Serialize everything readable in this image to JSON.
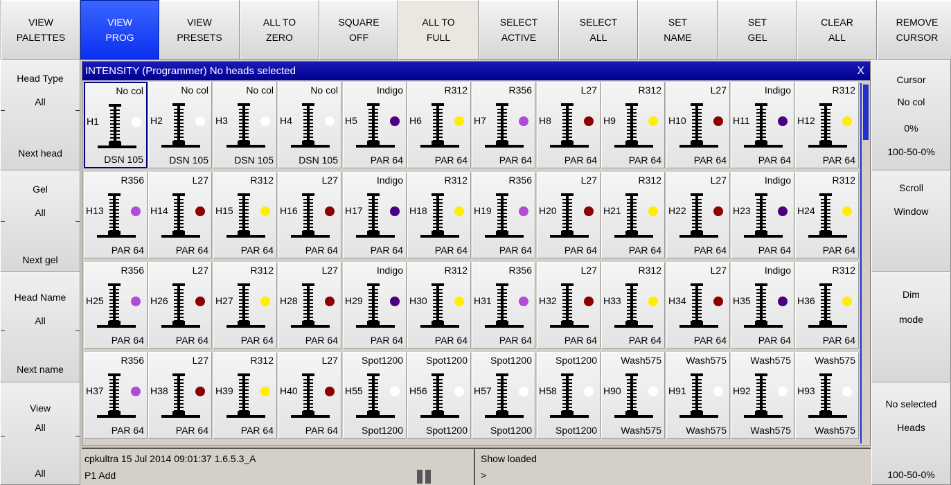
{
  "toolbar": [
    {
      "line1": "VIEW",
      "line2": "PALETTES",
      "state": "normal"
    },
    {
      "line1": "VIEW",
      "line2": "PROG",
      "state": "active"
    },
    {
      "line1": "VIEW",
      "line2": "PRESETS",
      "state": "normal"
    },
    {
      "line1": "ALL TO",
      "line2": "ZERO",
      "state": "normal"
    },
    {
      "line1": "SQUARE",
      "line2": "OFF",
      "state": "normal"
    },
    {
      "line1": "ALL TO",
      "line2": "FULL",
      "state": "pressed"
    },
    {
      "line1": "SELECT",
      "line2": "ACTIVE",
      "state": "normal"
    },
    {
      "line1": "SELECT",
      "line2": "ALL",
      "state": "normal"
    },
    {
      "line1": "SET",
      "line2": "NAME",
      "state": "normal"
    },
    {
      "line1": "SET",
      "line2": "GEL",
      "state": "normal"
    },
    {
      "line1": "CLEAR",
      "line2": "ALL",
      "state": "normal"
    },
    {
      "line1": "REMOVE",
      "line2": "CURSOR",
      "state": "normal"
    }
  ],
  "left_panel": [
    {
      "title": "Head Type",
      "value": "All",
      "footer": "Next head"
    },
    {
      "title": "Gel",
      "value": "All",
      "footer": "Next gel"
    },
    {
      "title": "Head Name",
      "value": "All",
      "footer": "Next name"
    },
    {
      "title": "View",
      "value": "All",
      "footer": "All"
    }
  ],
  "right_panel": {
    "cursor": {
      "title": "Cursor",
      "value": "No col",
      "percent": "0%",
      "range": "100-50-0%"
    },
    "scroll": {
      "line1": "Scroll",
      "line2": "Window"
    },
    "dim": {
      "line1": "Dim",
      "line2": "mode"
    },
    "heads": {
      "line1": "No selected",
      "line2": "Heads",
      "range": "100-50-0%"
    }
  },
  "window": {
    "title": "INTENSITY (Programmer) No heads selected",
    "close": "X"
  },
  "colors": {
    "white": "#ffffff",
    "purple": "#b44ad8",
    "yellow": "#ffee00",
    "darkred": "#8b0000",
    "indigo": "#4a0080",
    "accent": "#0b2ff0",
    "titlebar": "#000090"
  },
  "heads": [
    {
      "id": "H1",
      "gel": "No col",
      "type": "DSN 105",
      "dot": "white",
      "selected": true
    },
    {
      "id": "H2",
      "gel": "No col",
      "type": "DSN 105",
      "dot": "white"
    },
    {
      "id": "H3",
      "gel": "No col",
      "type": "DSN 105",
      "dot": "white"
    },
    {
      "id": "H4",
      "gel": "No col",
      "type": "DSN 105",
      "dot": "white"
    },
    {
      "id": "H5",
      "gel": "Indigo",
      "type": "PAR 64",
      "dot": "indigo"
    },
    {
      "id": "H6",
      "gel": "R312",
      "type": "PAR 64",
      "dot": "yellow"
    },
    {
      "id": "H7",
      "gel": "R356",
      "type": "PAR 64",
      "dot": "purple"
    },
    {
      "id": "H8",
      "gel": "L27",
      "type": "PAR 64",
      "dot": "darkred"
    },
    {
      "id": "H9",
      "gel": "R312",
      "type": "PAR 64",
      "dot": "yellow"
    },
    {
      "id": "H10",
      "gel": "L27",
      "type": "PAR 64",
      "dot": "darkred"
    },
    {
      "id": "H11",
      "gel": "Indigo",
      "type": "PAR 64",
      "dot": "indigo"
    },
    {
      "id": "H12",
      "gel": "R312",
      "type": "PAR 64",
      "dot": "yellow"
    },
    {
      "id": "H13",
      "gel": "R356",
      "type": "PAR 64",
      "dot": "purple"
    },
    {
      "id": "H14",
      "gel": "L27",
      "type": "PAR 64",
      "dot": "darkred"
    },
    {
      "id": "H15",
      "gel": "R312",
      "type": "PAR 64",
      "dot": "yellow"
    },
    {
      "id": "H16",
      "gel": "L27",
      "type": "PAR 64",
      "dot": "darkred"
    },
    {
      "id": "H17",
      "gel": "Indigo",
      "type": "PAR 64",
      "dot": "indigo"
    },
    {
      "id": "H18",
      "gel": "R312",
      "type": "PAR 64",
      "dot": "yellow"
    },
    {
      "id": "H19",
      "gel": "R356",
      "type": "PAR 64",
      "dot": "purple"
    },
    {
      "id": "H20",
      "gel": "L27",
      "type": "PAR 64",
      "dot": "darkred"
    },
    {
      "id": "H21",
      "gel": "R312",
      "type": "PAR 64",
      "dot": "yellow"
    },
    {
      "id": "H22",
      "gel": "L27",
      "type": "PAR 64",
      "dot": "darkred"
    },
    {
      "id": "H23",
      "gel": "Indigo",
      "type": "PAR 64",
      "dot": "indigo"
    },
    {
      "id": "H24",
      "gel": "R312",
      "type": "PAR 64",
      "dot": "yellow"
    },
    {
      "id": "H25",
      "gel": "R356",
      "type": "PAR 64",
      "dot": "purple"
    },
    {
      "id": "H26",
      "gel": "L27",
      "type": "PAR 64",
      "dot": "darkred"
    },
    {
      "id": "H27",
      "gel": "R312",
      "type": "PAR 64",
      "dot": "yellow"
    },
    {
      "id": "H28",
      "gel": "L27",
      "type": "PAR 64",
      "dot": "darkred"
    },
    {
      "id": "H29",
      "gel": "Indigo",
      "type": "PAR 64",
      "dot": "indigo"
    },
    {
      "id": "H30",
      "gel": "R312",
      "type": "PAR 64",
      "dot": "yellow"
    },
    {
      "id": "H31",
      "gel": "R356",
      "type": "PAR 64",
      "dot": "purple"
    },
    {
      "id": "H32",
      "gel": "L27",
      "type": "PAR 64",
      "dot": "darkred"
    },
    {
      "id": "H33",
      "gel": "R312",
      "type": "PAR 64",
      "dot": "yellow"
    },
    {
      "id": "H34",
      "gel": "L27",
      "type": "PAR 64",
      "dot": "darkred"
    },
    {
      "id": "H35",
      "gel": "Indigo",
      "type": "PAR 64",
      "dot": "indigo"
    },
    {
      "id": "H36",
      "gel": "R312",
      "type": "PAR 64",
      "dot": "yellow"
    },
    {
      "id": "H37",
      "gel": "R356",
      "type": "PAR 64",
      "dot": "purple"
    },
    {
      "id": "H38",
      "gel": "L27",
      "type": "PAR 64",
      "dot": "darkred"
    },
    {
      "id": "H39",
      "gel": "R312",
      "type": "PAR 64",
      "dot": "yellow"
    },
    {
      "id": "H40",
      "gel": "L27",
      "type": "PAR 64",
      "dot": "darkred"
    },
    {
      "id": "H55",
      "gel": "Spot1200",
      "type": "Spot1200",
      "dot": "white"
    },
    {
      "id": "H56",
      "gel": "Spot1200",
      "type": "Spot1200",
      "dot": "white"
    },
    {
      "id": "H57",
      "gel": "Spot1200",
      "type": "Spot1200",
      "dot": "white"
    },
    {
      "id": "H58",
      "gel": "Spot1200",
      "type": "Spot1200",
      "dot": "white"
    },
    {
      "id": "H90",
      "gel": "Wash575",
      "type": "Wash575",
      "dot": "white"
    },
    {
      "id": "H91",
      "gel": "Wash575",
      "type": "Wash575",
      "dot": "white"
    },
    {
      "id": "H92",
      "gel": "Wash575",
      "type": "Wash575",
      "dot": "white"
    },
    {
      "id": "H93",
      "gel": "Wash575",
      "type": "Wash575",
      "dot": "white"
    }
  ],
  "status": {
    "left_line1": "cpkultra 15 Jul 2014 09:01:37 1.6.5.3_A",
    "left_line2": "P1 Add",
    "right_line1": "Show loaded",
    "right_line2": ">"
  }
}
